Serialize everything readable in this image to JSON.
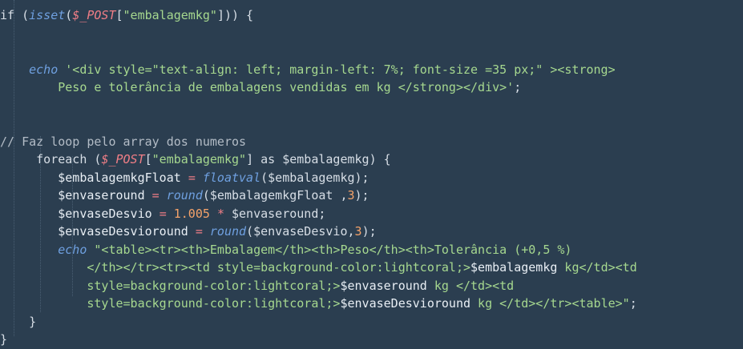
{
  "editor": {
    "lines": [
      {
        "indent": "",
        "tokens": [
          {
            "t": "if (",
            "c": "t-plain"
          },
          {
            "t": "isset",
            "c": "t-fn"
          },
          {
            "t": "(",
            "c": "t-plain"
          },
          {
            "t": "$_POST",
            "c": "t-postvar"
          },
          {
            "t": "[",
            "c": "t-plain"
          },
          {
            "t": "\"embalagemkg\"",
            "c": "t-str"
          },
          {
            "t": "])) {",
            "c": "t-plain"
          }
        ]
      },
      {
        "indent": "",
        "tokens": []
      },
      {
        "indent": "",
        "tokens": []
      },
      {
        "indent": "    ",
        "tokens": [
          {
            "t": "echo",
            "c": "t-echo"
          },
          {
            "t": " ",
            "c": "t-plain"
          },
          {
            "t": "'<div style=\"text-align: left; margin-left: 7%; font-size =35 px;\" ><strong>",
            "c": "t-str"
          }
        ]
      },
      {
        "indent": "        ",
        "tokens": [
          {
            "t": "Peso e tolerância de embalagens vendidas em kg </strong></div>'",
            "c": "t-str"
          },
          {
            "t": ";",
            "c": "t-plain"
          }
        ]
      },
      {
        "indent": "",
        "tokens": []
      },
      {
        "indent": "",
        "tokens": []
      },
      {
        "indent": "",
        "tokens": [
          {
            "t": "// Faz loop pelo array dos numeros",
            "c": "t-comment"
          }
        ]
      },
      {
        "indent": "     ",
        "tokens": [
          {
            "t": "foreach (",
            "c": "t-plain"
          },
          {
            "t": "$_POST",
            "c": "t-postvar"
          },
          {
            "t": "[",
            "c": "t-plain"
          },
          {
            "t": "\"embalagemkg\"",
            "c": "t-str"
          },
          {
            "t": "] as $embalagemkg) {",
            "c": "t-plain"
          }
        ]
      },
      {
        "indent": "        ",
        "tokens": [
          {
            "t": "$embalagemkgFloat ",
            "c": "t-var"
          },
          {
            "t": "=",
            "c": "t-op"
          },
          {
            "t": " ",
            "c": "t-plain"
          },
          {
            "t": "floatval",
            "c": "t-fn"
          },
          {
            "t": "($embalagemkg);",
            "c": "t-plain"
          }
        ]
      },
      {
        "indent": "        ",
        "tokens": [
          {
            "t": "$envaseround ",
            "c": "t-var"
          },
          {
            "t": "=",
            "c": "t-op"
          },
          {
            "t": " ",
            "c": "t-plain"
          },
          {
            "t": "round",
            "c": "t-fn"
          },
          {
            "t": "($embalagemkgFloat ,",
            "c": "t-plain"
          },
          {
            "t": "3",
            "c": "t-num"
          },
          {
            "t": ");",
            "c": "t-plain"
          }
        ]
      },
      {
        "indent": "        ",
        "tokens": [
          {
            "t": "$envaseDesvio ",
            "c": "t-var"
          },
          {
            "t": "=",
            "c": "t-op"
          },
          {
            "t": " ",
            "c": "t-plain"
          },
          {
            "t": "1.005",
            "c": "t-num"
          },
          {
            "t": " ",
            "c": "t-plain"
          },
          {
            "t": "*",
            "c": "t-op"
          },
          {
            "t": " $envaseround;",
            "c": "t-plain"
          }
        ]
      },
      {
        "indent": "        ",
        "tokens": [
          {
            "t": "$envaseDesvioround ",
            "c": "t-var"
          },
          {
            "t": "=",
            "c": "t-op"
          },
          {
            "t": " ",
            "c": "t-plain"
          },
          {
            "t": "round",
            "c": "t-fn"
          },
          {
            "t": "($envaseDesvio,",
            "c": "t-plain"
          },
          {
            "t": "3",
            "c": "t-num"
          },
          {
            "t": ");",
            "c": "t-plain"
          }
        ]
      },
      {
        "indent": "        ",
        "tokens": [
          {
            "t": "echo",
            "c": "t-echo"
          },
          {
            "t": " ",
            "c": "t-plain"
          },
          {
            "t": "\"<table><tr><th>Embalagem</th><th>Peso</th><th>Tolerância (+0,5 %)",
            "c": "t-str"
          }
        ]
      },
      {
        "indent": "            ",
        "tokens": [
          {
            "t": "</th></tr><tr><td style=background-color:lightcoral;>",
            "c": "t-str"
          },
          {
            "t": "$embalagemkg",
            "c": "t-var"
          },
          {
            "t": " kg</td><td",
            "c": "t-str"
          }
        ]
      },
      {
        "indent": "            ",
        "tokens": [
          {
            "t": "style=background-color:lightcoral;>",
            "c": "t-str"
          },
          {
            "t": "$envaseround",
            "c": "t-var"
          },
          {
            "t": " kg </td><td",
            "c": "t-str"
          }
        ]
      },
      {
        "indent": "            ",
        "tokens": [
          {
            "t": "style=background-color:lightcoral;>",
            "c": "t-str"
          },
          {
            "t": "$envaseDesvioround",
            "c": "t-var"
          },
          {
            "t": " kg </td></tr><table>\"",
            "c": "t-str"
          },
          {
            "t": ";",
            "c": "t-plain"
          }
        ]
      },
      {
        "indent": "    ",
        "tokens": [
          {
            "t": "}",
            "c": "t-plain"
          }
        ]
      },
      {
        "indent": "",
        "tokens": [
          {
            "t": "}",
            "c": "t-plain"
          }
        ]
      }
    ]
  },
  "colors": {
    "background": "#2b3e50",
    "plain": "#d7dee6",
    "function": "#6fa0e0",
    "post_var": "#f07e86",
    "string": "#a6d88f",
    "number": "#f5a36a",
    "operator": "#f07e86",
    "comment": "#b3bcc6"
  }
}
